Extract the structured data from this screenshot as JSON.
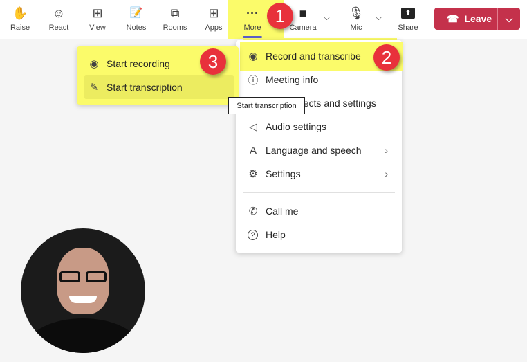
{
  "toolbar": {
    "items": [
      {
        "label": "Raise",
        "icon": "hand-icon",
        "glyph": "✋"
      },
      {
        "label": "React",
        "icon": "smiley-icon",
        "glyph": "☺"
      },
      {
        "label": "View",
        "icon": "grid-icon",
        "glyph": "⊞"
      },
      {
        "label": "Notes",
        "icon": "notes-icon",
        "glyph": "📝"
      },
      {
        "label": "Rooms",
        "icon": "rooms-icon",
        "glyph": "⧉"
      },
      {
        "label": "Apps",
        "icon": "plus-box-icon",
        "glyph": "⊞"
      },
      {
        "label": "More",
        "icon": "more-icon",
        "glyph": "···"
      },
      {
        "label": "Camera",
        "icon": "camera-off-icon",
        "glyph": "■"
      },
      {
        "label": "Mic",
        "icon": "mic-icon",
        "glyph": "🎙"
      },
      {
        "label": "Share",
        "icon": "share-icon",
        "glyph": "⬆"
      }
    ],
    "leave_label": "Leave"
  },
  "more_menu": {
    "items": [
      {
        "label": "Record and transcribe",
        "icon": "record-icon",
        "glyph": "◉"
      },
      {
        "label": "Meeting info",
        "icon": "info-icon",
        "glyph": "ⓘ"
      },
      {
        "label": "Video effects and settings",
        "icon": "video-effects-icon",
        "glyph": "▭"
      },
      {
        "label": "Audio settings",
        "icon": "speaker-settings-icon",
        "glyph": "◁"
      },
      {
        "label": "Language and speech",
        "icon": "language-icon",
        "glyph": "A"
      },
      {
        "label": "Settings",
        "icon": "gear-icon",
        "glyph": "⚙"
      },
      {
        "label": "Call me",
        "icon": "phone-icon",
        "glyph": "✆"
      },
      {
        "label": "Help",
        "icon": "help-icon",
        "glyph": "?"
      }
    ]
  },
  "submenu": {
    "items": [
      {
        "label": "Start recording",
        "icon": "record-icon",
        "glyph": "◉"
      },
      {
        "label": "Start transcription",
        "icon": "transcription-icon",
        "glyph": "✎"
      }
    ]
  },
  "tooltip": "Start transcription",
  "badges": [
    "1",
    "2",
    "3"
  ],
  "colors": {
    "highlight": "#fbfb6a",
    "leave": "#c4314b",
    "badge": "#e8313b",
    "accent": "#5b5fc7"
  }
}
